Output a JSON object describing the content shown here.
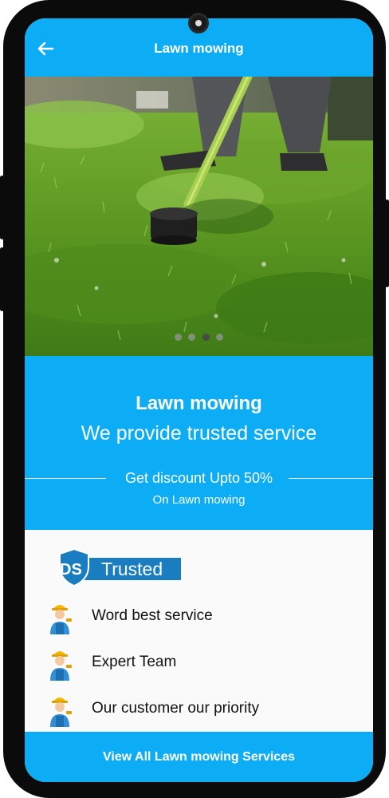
{
  "appbar": {
    "title": "Lawn mowing",
    "back_icon": "arrow-left-icon"
  },
  "carousel": {
    "image": "lawn-trimmer-photo",
    "total_slides": 4,
    "active_slide": 3
  },
  "promo": {
    "title": "Lawn mowing",
    "subtitle": "We provide trusted service",
    "discount": "Get discount Upto 50%",
    "discount_target": "On Lawn mowing"
  },
  "trusted": {
    "badge_letters": "DS",
    "badge_text": "Trusted",
    "badge_icon": "shield-icon"
  },
  "features": [
    {
      "label": "Word best service",
      "icon": "worker-icon"
    },
    {
      "label": "Expert Team",
      "icon": "worker-icon"
    },
    {
      "label": "Our customer our priority",
      "icon": "worker-icon"
    }
  ],
  "footer": {
    "cta_label": "View All Lawn mowing Services"
  },
  "colors": {
    "primary": "#0dadf5",
    "badge_blue": "#1a7dbf",
    "phone_frame": "#0b0b0b"
  }
}
